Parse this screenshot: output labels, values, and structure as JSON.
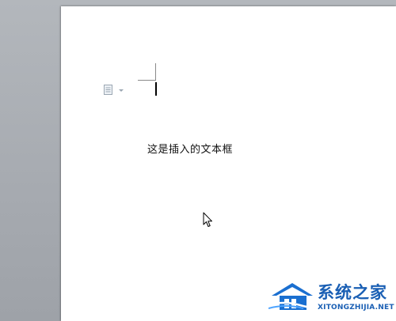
{
  "document": {
    "textbox_text": "这是插入的文本框"
  },
  "icons": {
    "paste_options": "paste-options-icon",
    "mouse_pointer": "mouse-pointer-icon"
  },
  "watermark": {
    "title": "系统之家",
    "url": "XITONGZHIJIA.NET"
  },
  "colors": {
    "workspace_background": "#a9adb3",
    "page_background": "#ffffff",
    "watermark_blue": "#1a5fb4"
  }
}
